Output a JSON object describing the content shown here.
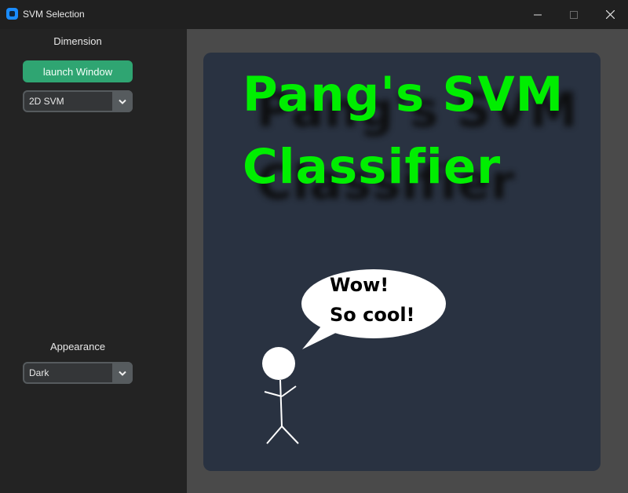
{
  "window": {
    "title": "SVM Selection"
  },
  "sidebar": {
    "dimension_label": "Dimension",
    "launch_button": "launch Window",
    "dimension_select": {
      "value": "2D SVM"
    },
    "appearance_label": "Appearance",
    "appearance_select": {
      "value": "Dark"
    }
  },
  "banner": {
    "title_line1": "Pang's SVM",
    "title_line2": "Classifier",
    "speech_line1": "Wow!",
    "speech_line2": "So cool!"
  },
  "colors": {
    "accent_button": "#2fa572",
    "title_green": "#00ee00",
    "panel_bg": "#293241",
    "content_bg": "#4a4a4a",
    "sidebar_bg": "#232323"
  },
  "icons": {
    "app": "app-icon",
    "minimize": "minimize-icon",
    "maximize": "maximize-icon",
    "close": "close-icon",
    "dropdown": "chevron-down-icon"
  }
}
